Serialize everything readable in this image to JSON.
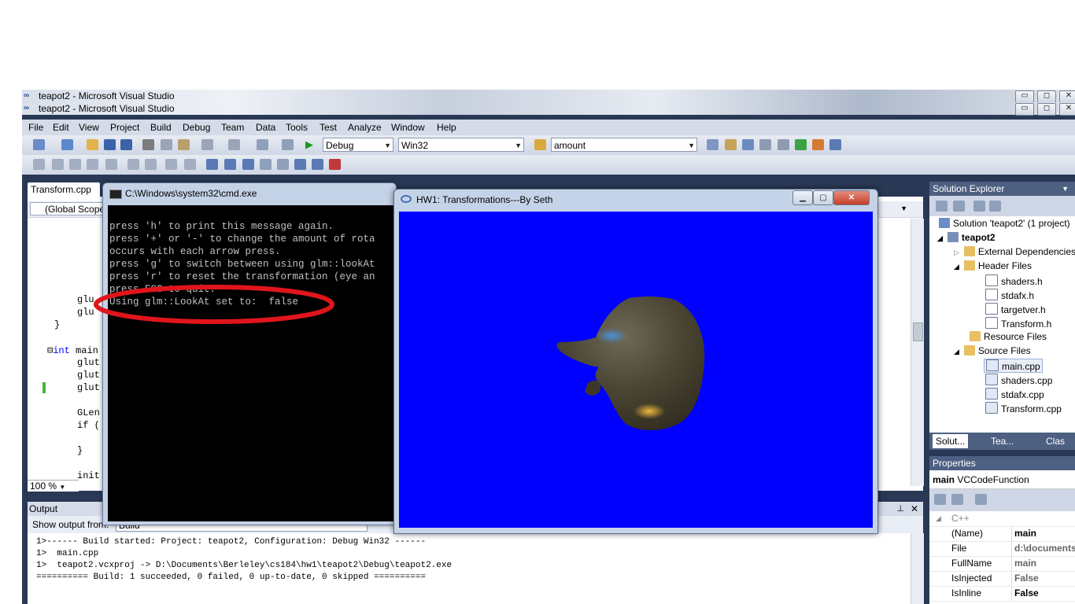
{
  "window": {
    "title": "teapot2 - Microsoft Visual Studio",
    "title_dup": "teapot2 - Microsoft Visual Studio",
    "min": "▭",
    "max": "◻",
    "close": "✕"
  },
  "menu": [
    "File",
    "Edit",
    "View",
    "Project",
    "Build",
    "Debug",
    "Team",
    "Data",
    "Tools",
    "Test",
    "Analyze",
    "Window",
    "Help"
  ],
  "toolbar": {
    "config": "Debug",
    "platform": "Win32",
    "find": "amount"
  },
  "editor": {
    "tab": "Transform.cpp",
    "scope": "(Global Scope",
    "zoom": "100 %",
    "lines": [
      {
        "text": "glu"
      },
      {
        "text": "glu"
      },
      {
        "text": "}"
      },
      {
        "kw": "int",
        "text": " main"
      },
      {
        "text": "glut"
      },
      {
        "text": "glut"
      },
      {
        "text": "glut"
      },
      {
        "text": "GLen"
      },
      {
        "text": "if ("
      },
      {
        "text": "}"
      },
      {
        "text": "init"
      }
    ]
  },
  "output": {
    "title": "Output",
    "show_from": "Show output from:",
    "source": "Build",
    "lines": [
      "1>------ Build started: Project: teapot2, Configuration: Debug Win32 ------",
      "1>  main.cpp",
      "1>  teapot2.vcxproj -> D:\\Documents\\Berleley\\cs184\\hw1\\teapot2\\Debug\\teapot2.exe",
      "========== Build: 1 succeeded, 0 failed, 0 up-to-date, 0 skipped =========="
    ]
  },
  "solution_explorer": {
    "title": "Solution Explorer",
    "items": [
      {
        "label": "Solution 'teapot2' (1 project)",
        "icon": "solution-icon"
      },
      {
        "label": "teapot2",
        "icon": "project-icon"
      },
      {
        "label": "External Dependencies",
        "icon": "folder-icon"
      },
      {
        "label": "Header Files",
        "icon": "folder-icon"
      },
      {
        "label": "shaders.h",
        "icon": "header-file-icon"
      },
      {
        "label": "stdafx.h",
        "icon": "header-file-icon"
      },
      {
        "label": "targetver.h",
        "icon": "header-file-icon"
      },
      {
        "label": "Transform.h",
        "icon": "header-file-icon"
      },
      {
        "label": "Resource Files",
        "icon": "folder-icon"
      },
      {
        "label": "Source Files",
        "icon": "folder-icon"
      },
      {
        "label": "main.cpp",
        "icon": "cpp-file-icon"
      },
      {
        "label": "shaders.cpp",
        "icon": "cpp-file-icon"
      },
      {
        "label": "stdafx.cpp",
        "icon": "cpp-file-icon"
      },
      {
        "label": "Transform.cpp",
        "icon": "cpp-file-icon"
      }
    ],
    "tabs": [
      "Solut...",
      "Tea...",
      "Clas"
    ]
  },
  "properties": {
    "title": "Properties",
    "object": "main",
    "object_type": "VCCodeFunction",
    "category": "C++",
    "rows": [
      {
        "name": "(Name)",
        "value": "main"
      },
      {
        "name": "File",
        "value": "d:\\documents\\"
      },
      {
        "name": "FullName",
        "value": "main"
      },
      {
        "name": "IsInjected",
        "value": "False"
      },
      {
        "name": "IsInline",
        "value": "False"
      }
    ]
  },
  "cmd": {
    "title": "C:\\Windows\\system32\\cmd.exe",
    "lines": [
      "press 'h' to print this message again.",
      "press '+' or '-' to change the amount of rota",
      "occurs with each arrow press.",
      "press 'g' to switch between using glm::lookAt",
      "press 'r' to reset the transformation (eye an",
      "press ESC to quit.",
      "Using glm::LookAt set to:  false"
    ]
  },
  "glwindow": {
    "title": "HW1: Transformations---By Seth",
    "background": "#0000ff"
  },
  "colors": {
    "vs_frame": "#293955",
    "annotation_red": "#e0151c"
  }
}
